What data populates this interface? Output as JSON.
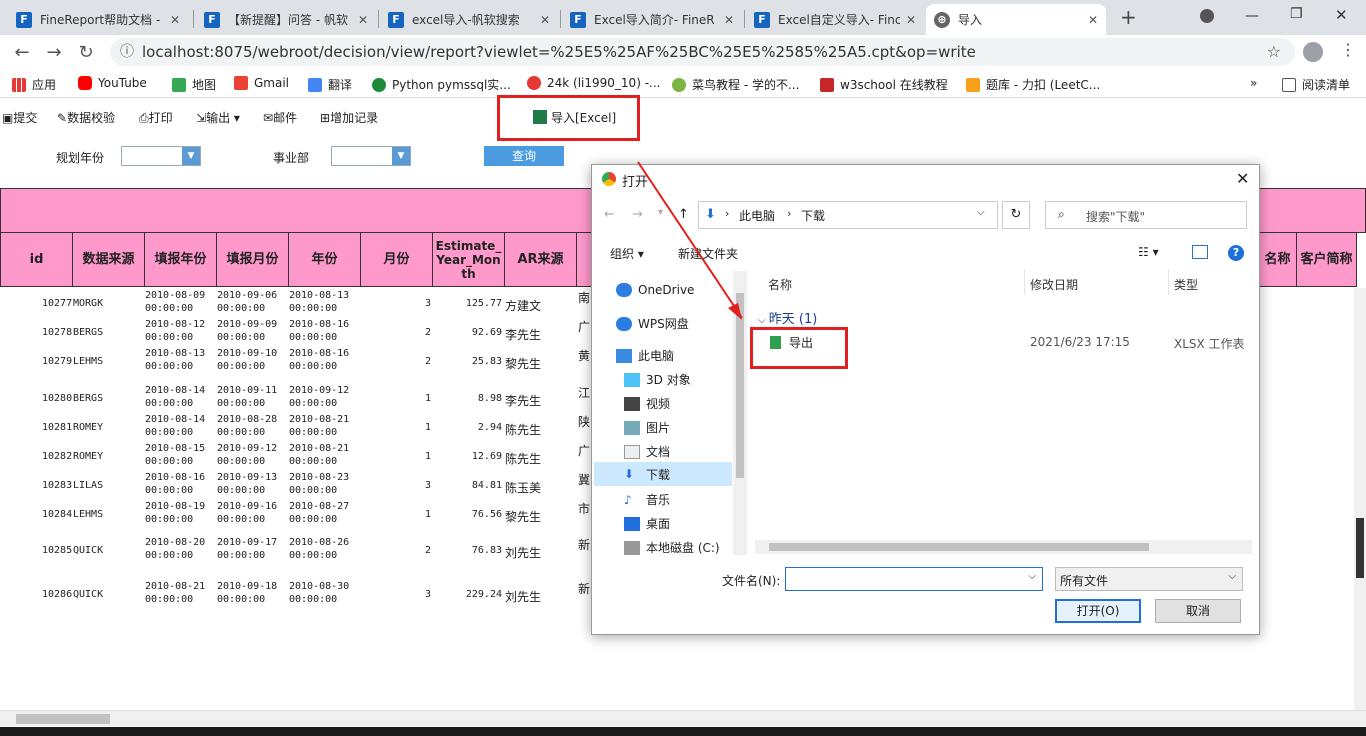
{
  "tabs": [
    {
      "title": "FineReport帮助文档 -"
    },
    {
      "title": "【新提醒】问答 - 帆软"
    },
    {
      "title": "excel导入-帆软搜索"
    },
    {
      "title": "Excel导入简介- FineR"
    },
    {
      "title": "Excel自定义导入- Finc"
    },
    {
      "title": "导入"
    }
  ],
  "url": "localhost:8075/webroot/decision/view/report?viewlet=%25E5%25AF%25BC%25E5%2585%25A5.cpt&op=write",
  "bookmarks": [
    "应用",
    "YouTube",
    "地图",
    "Gmail",
    "翻译",
    "Python pymssql实...",
    "24k (li1990_10) -...",
    "菜鸟教程 - 学的不...",
    "w3school 在线教程",
    "题库 - 力扣 (LeetC..."
  ],
  "reading_list": "阅读清单",
  "toolbar": [
    "提交",
    "数据校验",
    "打印",
    "输出",
    "邮件",
    "增加记录"
  ],
  "import_excel": "导入[Excel]",
  "filter": {
    "year_label": "规划年份",
    "dept_label": "事业部",
    "query": "查询"
  },
  "columns": [
    "id",
    "数据来源",
    "填报年份",
    "填报月份",
    "年份",
    "月份",
    "Estimate_Year_Month",
    "AR来源"
  ],
  "right_columns": [
    "名称",
    "客户简称"
  ],
  "rows": [
    {
      "id": "10277",
      "src": "MORGK",
      "d1": "2010-08-09",
      "d2": "2010-09-06",
      "d3": "2010-08-13",
      "m": "3",
      "v": "125.77",
      "p": "方建文",
      "a": "南"
    },
    {
      "id": "10278",
      "src": "BERGS",
      "d1": "2010-08-12",
      "d2": "2010-09-09",
      "d3": "2010-08-16",
      "m": "2",
      "v": "92.69",
      "p": "李先生",
      "a": "广"
    },
    {
      "id": "10279",
      "src": "LEHMS",
      "d1": "2010-08-13",
      "d2": "2010-09-10",
      "d3": "2010-08-16",
      "m": "2",
      "v": "25.83",
      "p": "黎先生",
      "a": "黄"
    },
    {
      "id": "10280",
      "src": "BERGS",
      "d1": "2010-08-14",
      "d2": "2010-09-11",
      "d3": "2010-09-12",
      "m": "1",
      "v": "8.98",
      "p": "李先生",
      "a": "江"
    },
    {
      "id": "10281",
      "src": "ROMEY",
      "d1": "2010-08-14",
      "d2": "2010-08-28",
      "d3": "2010-08-21",
      "m": "1",
      "v": "2.94",
      "p": "陈先生",
      "a": "陕"
    },
    {
      "id": "10282",
      "src": "ROMEY",
      "d1": "2010-08-15",
      "d2": "2010-09-12",
      "d3": "2010-08-21",
      "m": "1",
      "v": "12.69",
      "p": "陈先生",
      "a": "广"
    },
    {
      "id": "10283",
      "src": "LILAS",
      "d1": "2010-08-16",
      "d2": "2010-09-13",
      "d3": "2010-08-23",
      "m": "3",
      "v": "84.81",
      "p": "陈玉美",
      "a": "冀"
    },
    {
      "id": "10284",
      "src": "LEHMS",
      "d1": "2010-08-19",
      "d2": "2010-09-16",
      "d3": "2010-08-27",
      "m": "1",
      "v": "76.56",
      "p": "黎先生",
      "a": "市"
    },
    {
      "id": "10285",
      "src": "QUICK",
      "d1": "2010-08-20",
      "d2": "2010-09-17",
      "d3": "2010-08-26",
      "m": "2",
      "v": "76.83",
      "p": "刘先生",
      "a": "新"
    },
    {
      "id": "10286",
      "src": "QUICK",
      "d1": "2010-08-21",
      "d2": "2010-09-18",
      "d3": "2010-08-30",
      "m": "3",
      "v": "229.24",
      "p": "刘先生",
      "a": "新"
    }
  ],
  "time": "00:00:00",
  "dialog": {
    "title": "打开",
    "path": [
      "此电脑",
      "下载"
    ],
    "search_placeholder": "搜索\"下载\"",
    "organize": "组织",
    "new_folder": "新建文件夹",
    "tree": [
      "OneDrive",
      "WPS网盘",
      "此电脑",
      "3D 对象",
      "视频",
      "图片",
      "文档",
      "下载",
      "音乐",
      "桌面",
      "本地磁盘 (C:)"
    ],
    "col_name": "名称",
    "col_date": "修改日期",
    "col_type": "类型",
    "group": "昨天 (1)",
    "file": {
      "name": "导出",
      "date": "2021/6/23 17:15",
      "type": "XLSX 工作表"
    },
    "filename_label": "文件名(N):",
    "filetype": "所有文件",
    "open": "打开(O)",
    "cancel": "取消"
  }
}
